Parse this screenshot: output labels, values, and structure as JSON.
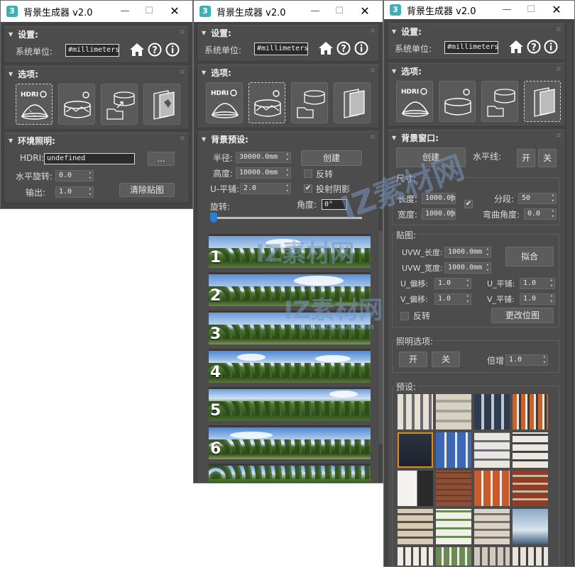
{
  "app": {
    "title": "背景生成器 v2.0",
    "logo_letter": "3"
  },
  "window_controls": {
    "minimize": "—",
    "maximize": "☐",
    "close": "✕"
  },
  "common": {
    "settings": "设置:",
    "unit_label": "系统单位:",
    "unit_value": "#millimeters",
    "options": "选项:"
  },
  "window1": {
    "env_header": "环境照明:",
    "hdri_label": "HDRI:",
    "hdri_value": "undefined",
    "browse": "...",
    "hrot_label": "水平旋转:",
    "hrot_value": "0.0",
    "output_label": "输出:",
    "output_value": "1.0",
    "clear_map": "清除贴图"
  },
  "window2": {
    "preset_header": "背景预设:",
    "radius_label": "半径:",
    "radius_value": "30000.0mm",
    "height_label": "高度:",
    "height_value": "10000.0mm",
    "utile_label": "U-平铺:",
    "utile_value": "2.0",
    "create": "创建",
    "flip": "反转",
    "cast_shadow": "投射阴影",
    "rotate_label": "旋转:",
    "angle_label": "角度:",
    "angle_value": "0°",
    "presets": [
      "1",
      "2",
      "3",
      "4",
      "5",
      "6"
    ]
  },
  "window3": {
    "bg_header": "背景窗口:",
    "create": "创建",
    "horizon_label": "水平线:",
    "on": "开",
    "off": "关",
    "size_group": "尺寸:",
    "length_label": "长度:",
    "length_value": "1000.0mm",
    "width_label": "宽度:",
    "width_value": "1000.0mm",
    "segments_label": "分段:",
    "segments_value": "50",
    "bend_label": "弯曲角度:",
    "bend_value": "0.0",
    "map_group": "贴图:",
    "uvw_len_label": "UVW_长度:",
    "uvw_len_value": "1000.0mm",
    "uvw_wid_label": "UVW_宽度:",
    "uvw_wid_value": "1000.0mm",
    "fit": "拟合",
    "u_offset_label": "U_偏移:",
    "u_offset_value": "1.0",
    "v_offset_label": "V_偏移:",
    "v_offset_value": "1.0",
    "u_tile_label": "U_平铺:",
    "u_tile_value": "1.0",
    "v_tile_label": "V_平铺:",
    "v_tile_value": "1.0",
    "flip": "反转",
    "change_map": "更改位图",
    "light_group": "照明选项:",
    "multiplier_label": "倍增",
    "multiplier_value": "1.0",
    "preset_group": "预设:"
  },
  "option_icons": [
    "hdri-dome-icon",
    "panorama-cylinder-icon",
    "import-map-icon",
    "window-backdrop-icon"
  ],
  "watermark": {
    "text": "IZ素材网",
    "sub": "WWW.ZSUCAI.COM"
  },
  "colors": {
    "panel": "#444444",
    "rollout": "#4c4c4c",
    "accent": "#2a7fd6",
    "logo": "#3bb0b6"
  }
}
